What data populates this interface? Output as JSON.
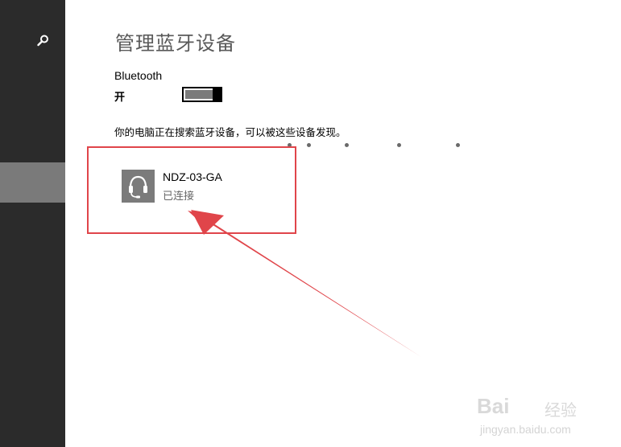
{
  "sidebar": {
    "search_icon": "search-icon",
    "selected_item_color": "#7a7a7a",
    "background_color": "#2b2b2b"
  },
  "page": {
    "title": "管理蓝牙设备",
    "bluetooth_label": "Bluetooth",
    "bluetooth_state": "开",
    "bluetooth_on": true,
    "status_text": "你的电脑正在搜索蓝牙设备，可以被这些设备发现。"
  },
  "devices": [
    {
      "name": "NDZ-03-GA",
      "status": "已连接",
      "icon": "headset-icon"
    }
  ],
  "annotation": {
    "highlight_color": "#e0454a",
    "arrow_color": "#e0454a"
  },
  "watermark": {
    "logo": "Bai",
    "brand": "经验",
    "url": "jingyan.baidu.com"
  }
}
